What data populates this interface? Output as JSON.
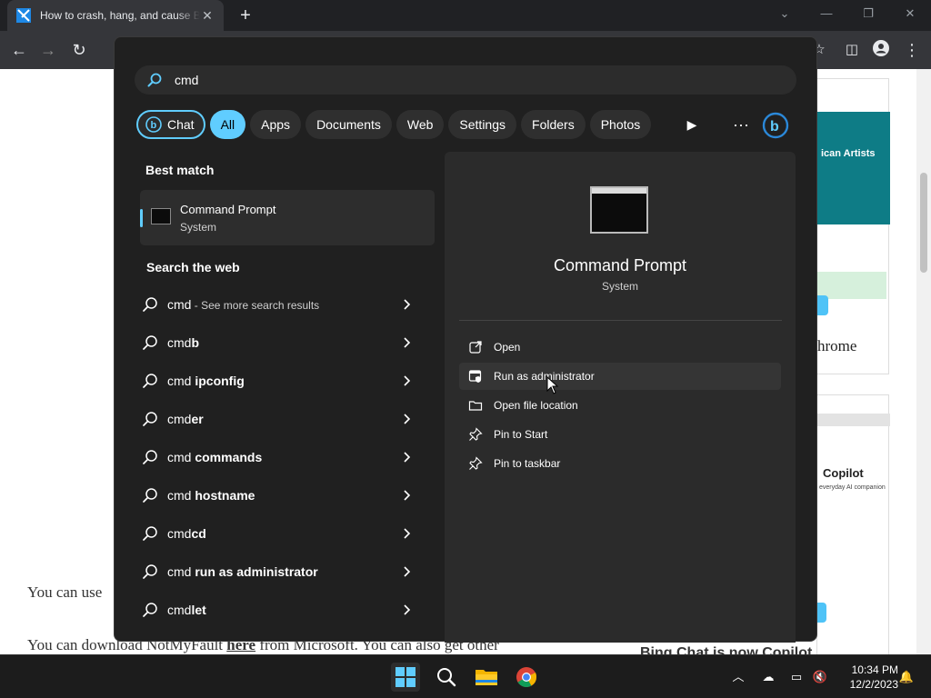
{
  "browser": {
    "tab_title": "How to crash, hang, and cause BSOD",
    "new_tab_icon": "plus-icon",
    "colors": {
      "tabbar": "#202124",
      "toolbar": "#35363a"
    }
  },
  "page": {
    "para1_start": "You can use",
    "para2_a": "You can download NotMyFault ",
    "para2_link": "here",
    "para2_b": " from Microsoft. You can also get other",
    "card_heading": "ican Artists",
    "card_label_chrome": "hrome",
    "card_copilot": "Copilot",
    "card_copilot_sub": "everyday AI companion",
    "bottom_heading": "Bing Chat is now Copilot"
  },
  "search": {
    "query": "cmd",
    "filters": [
      "Chat",
      "All",
      "Apps",
      "Documents",
      "Web",
      "Settings",
      "Folders",
      "Photos"
    ],
    "active_filter": "All"
  },
  "results": {
    "best_match_title": "Best match",
    "best_match": {
      "name": "Command Prompt",
      "type": "System"
    },
    "web_title": "Search the web",
    "web_items": [
      {
        "prefix": "cmd",
        "bold": "",
        "suffix": " - See more search results"
      },
      {
        "prefix": "cmd",
        "bold": "b",
        "suffix": ""
      },
      {
        "prefix": "cmd ",
        "bold": "ipconfig",
        "suffix": ""
      },
      {
        "prefix": "cmd",
        "bold": "er",
        "suffix": ""
      },
      {
        "prefix": "cmd ",
        "bold": "commands",
        "suffix": ""
      },
      {
        "prefix": "cmd ",
        "bold": "hostname",
        "suffix": ""
      },
      {
        "prefix": "cmd",
        "bold": "cd",
        "suffix": ""
      },
      {
        "prefix": "cmd ",
        "bold": "run as administrator",
        "suffix": ""
      },
      {
        "prefix": "cmd",
        "bold": "let",
        "suffix": ""
      }
    ]
  },
  "preview": {
    "title": "Command Prompt",
    "subtitle": "System",
    "actions": [
      {
        "label": "Open",
        "icon": "open-external-icon"
      },
      {
        "label": "Run as administrator",
        "icon": "shield-admin-icon"
      },
      {
        "label": "Open file location",
        "icon": "folder-icon"
      },
      {
        "label": "Pin to Start",
        "icon": "pin-icon"
      },
      {
        "label": "Pin to taskbar",
        "icon": "pin-icon"
      }
    ]
  },
  "taskbar": {
    "time": "10:34 PM",
    "date": "12/2/2023"
  },
  "colors": {
    "accent": "#60cdff",
    "panel_bg": "#202020",
    "preview_bg": "#2b2b2b"
  }
}
